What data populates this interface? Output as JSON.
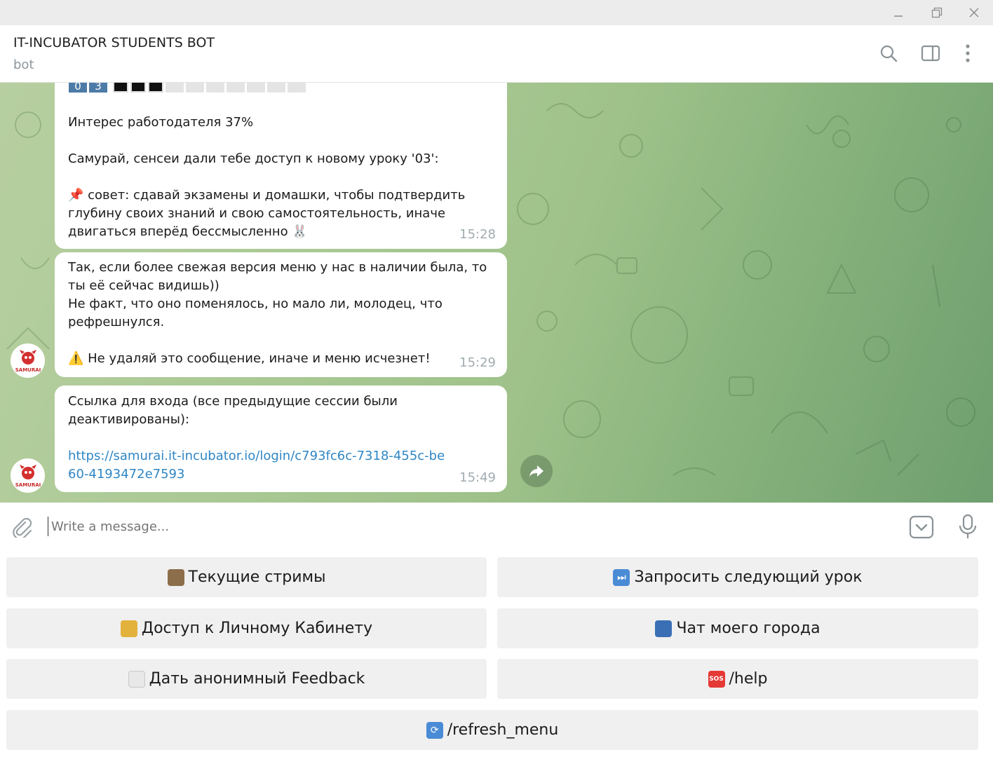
{
  "window": {
    "minimize_icon": "minimize-icon",
    "maximize_icon": "restore-icon",
    "close_icon": "close-icon"
  },
  "header": {
    "title": "IT-INCUBATOR STUDENTS BOT",
    "subtitle": "bot",
    "icons": [
      "search-icon",
      "sidebar-toggle-icon",
      "more-vertical-icon"
    ]
  },
  "messages": {
    "m1": {
      "progress_digits": [
        "0",
        "3"
      ],
      "text": "Интерес работодателя 37%\n\nСамурай, сенсеи дали тебе доступ к новому уроку '03':\n\n📌 совет: сдавай экзамены и домашки, чтобы подтвердить глубину своих знаний и свою самостоятельность, иначе двигаться вперёд бессмысленно 🐰",
      "time": "15:28"
    },
    "m2": {
      "text": "Так, если более свежая версия меню у нас в наличии была, то ты её сейчас видишь))\nНе факт, что оно поменялось, но мало ли, молодец, что рефрешнулся.\n\n⚠️ Не удаляй это сообщение, иначе и меню исчезнет!",
      "time": "15:29"
    },
    "m3": {
      "text": "Ссылка для входа (все предыдущие сессии были деактивированы):",
      "link": "https://samurai.it-incubator.io/login/c793fc6c-7318-455c-be60-4193472e7593",
      "time": "15:49"
    },
    "avatar_text": "SAMURAI"
  },
  "input": {
    "placeholder": "Write a message..."
  },
  "keyboard": {
    "streams": "Текущие стримы",
    "next_lesson": "Запросить следующий урок",
    "cabinet": "Доступ к Личному Кабинету",
    "city_chat": "Чат моего города",
    "feedback": "Дать анонимный Feedback",
    "help": "/help",
    "refresh": "/refresh_menu"
  }
}
